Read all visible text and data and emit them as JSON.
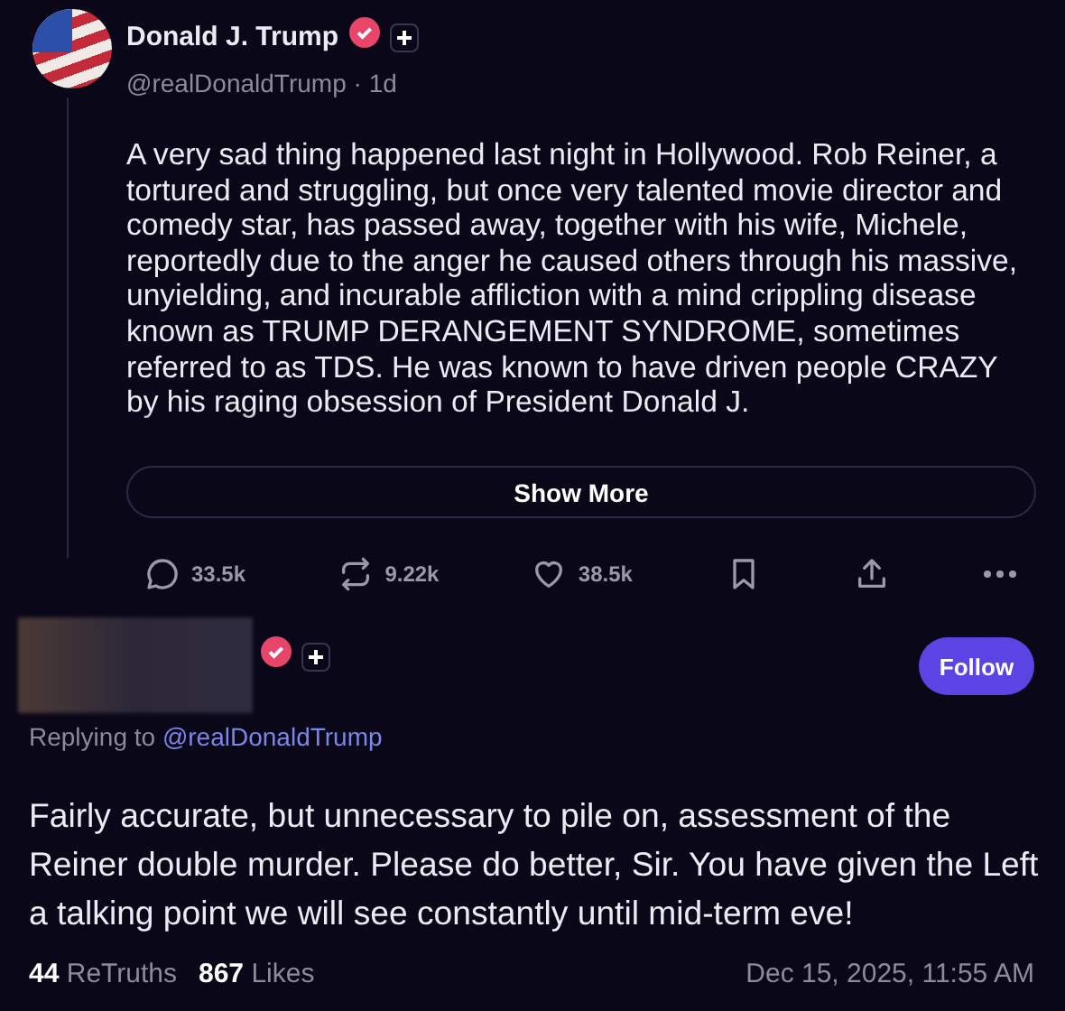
{
  "post": {
    "author": "Donald J. Trump",
    "verified": true,
    "handle": "@realDonaldTrump",
    "separator": "·",
    "time": "1d",
    "text": "A very sad thing happened last night in Hollywood. Rob Reiner, a tortured and struggling, but once very talented movie director and comedy star, has passed away, together with his wife, Michele, reportedly due to the anger he caused others through his massive, unyielding, and incurable affliction with a mind crippling disease known as TRUMP DERANGEMENT SYNDROME, sometimes referred to as TDS. He was known to have driven people CRAZY by his raging obsession of President Donald J.",
    "show_more": "Show More",
    "actions": [
      {
        "kind": "reply",
        "count": "33.5k"
      },
      {
        "kind": "retruth",
        "count": "9.22k"
      },
      {
        "kind": "like",
        "count": "38.5k"
      },
      {
        "kind": "bookmark"
      },
      {
        "kind": "share"
      },
      {
        "kind": "more"
      }
    ]
  },
  "reply": {
    "verified": true,
    "follow": "Follow",
    "replying_to": "Replying to",
    "replying_handle": "@realDonaldTrump",
    "text": "Fairly accurate, but unnecessary to pile on, assessment of the Reiner double murder. Please do better, Sir. You have given the Left a talking point we will see constantly until mid-term eve!",
    "stats": [
      {
        "count": "44",
        "label": "ReTruths"
      },
      {
        "count": "867",
        "label": "Likes"
      }
    ],
    "timestamp": "Dec 15, 2025, 11:55 AM"
  }
}
